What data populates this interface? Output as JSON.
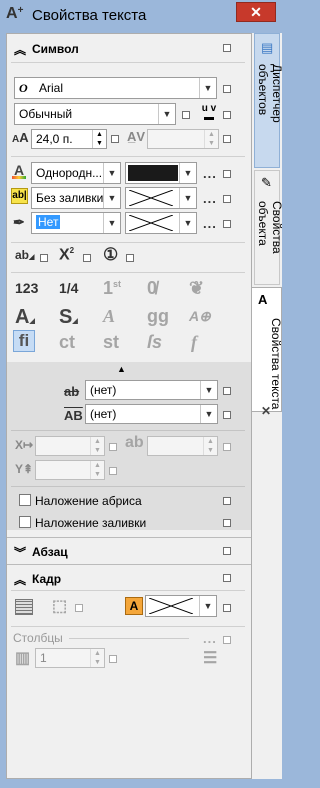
{
  "window": {
    "title": "Свойства текста",
    "minimize_label": "−",
    "maximize_label": "□",
    "close_label": "✕"
  },
  "sections": {
    "symbol": "Символ",
    "paragraph": "Абзац",
    "frame": "Кадр"
  },
  "symbol": {
    "font_name": "Arial",
    "font_style": "Обычный",
    "font_size": "24,0 п.",
    "kerning_value": "",
    "fill_type": "Однородн...",
    "fill_color": "#1a1a1a",
    "background_type": "Без заливки",
    "outline_type": "Нет",
    "strike_value": "(нет)",
    "overline_value": "(нет)",
    "outline_overlay_label": "Наложение абриса",
    "fill_overlay_label": "Наложение заливки"
  },
  "frame": {
    "columns_label": "Столбцы",
    "columns_value": "1"
  },
  "right_tabs": [
    {
      "label": "Диспетчер объектов"
    },
    {
      "label": "Свойства объекта"
    },
    {
      "label": "Свойства текста"
    }
  ],
  "glyphs": {
    "more": "...",
    "uv": "u v"
  },
  "accent_colors": {
    "titlebar": "#9bb7da",
    "selection": "#3399ff",
    "close": "#c7392b"
  }
}
